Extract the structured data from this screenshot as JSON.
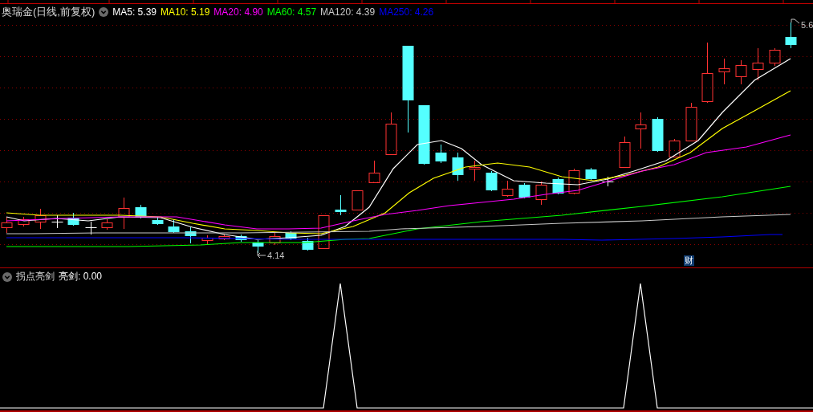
{
  "main_chart": {
    "title": "奥瑞金(日线,前复权)",
    "indicators": [
      {
        "label": "MA5: 5.39",
        "color": "#ffffff"
      },
      {
        "label": "MA10: 5.19",
        "color": "#ffff00"
      },
      {
        "label": "MA20: 4.90",
        "color": "#ff00ff"
      },
      {
        "label": "MA60: 4.57",
        "color": "#00ff00"
      },
      {
        "label": "MA120: 4.39",
        "color": "#c8c8c8"
      },
      {
        "label": "MA250: 4.26",
        "color": "#0000ff"
      }
    ],
    "high_label": "5.6",
    "low_label": "4.14",
    "event_marker": "财"
  },
  "sub_chart": {
    "title": "拐点亮剑",
    "reading": "亮剑: 0.00"
  }
}
